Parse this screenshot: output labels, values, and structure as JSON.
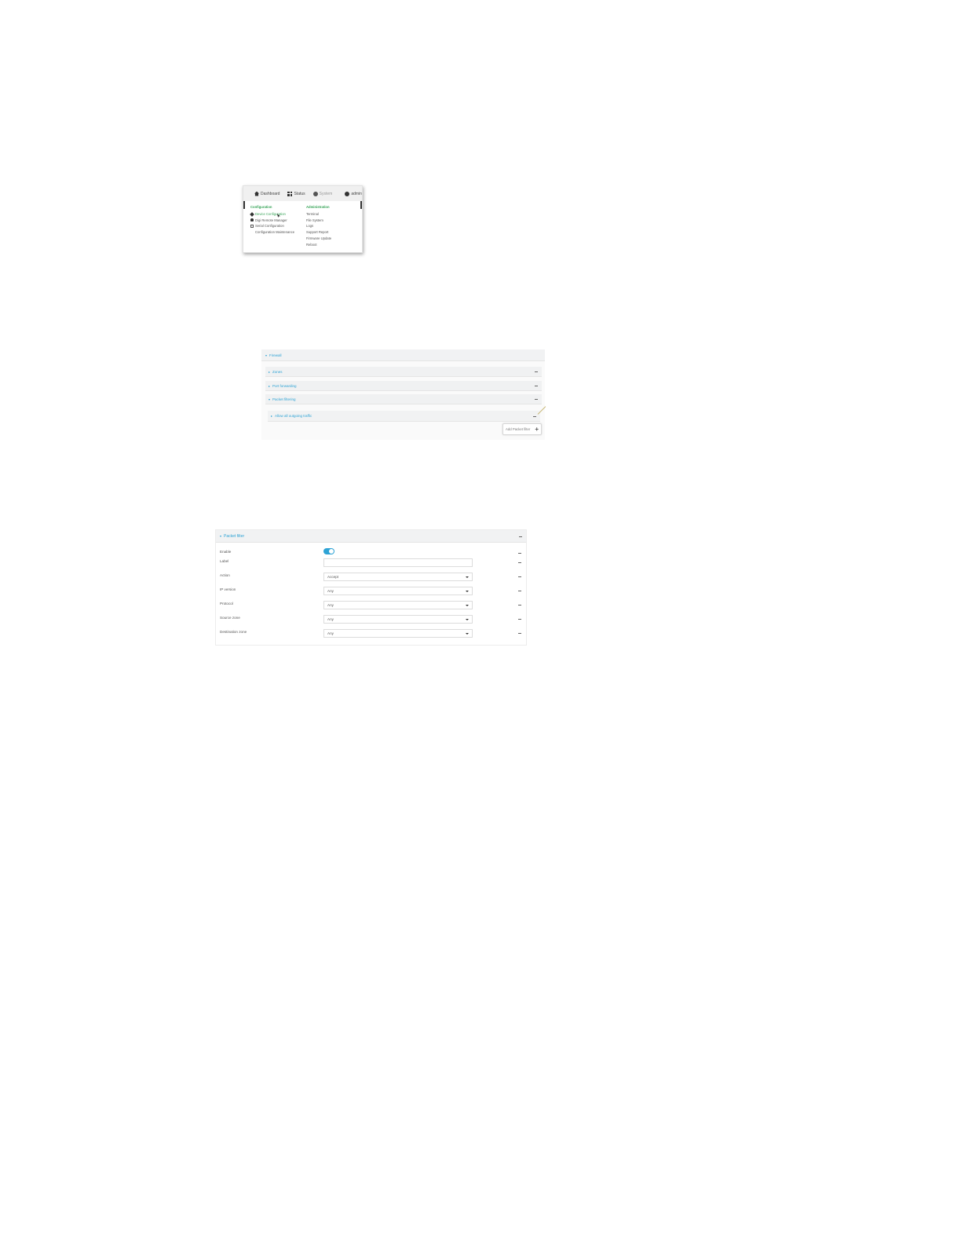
{
  "menu": {
    "nav": {
      "dashboard": "Dashboard",
      "status": "Status",
      "system": "System",
      "admin": "admin"
    },
    "configuration": {
      "heading": "Configuration",
      "items": [
        {
          "label": "Device Configuration",
          "icon": "wrench-icon",
          "active": true
        },
        {
          "label": "Digi Remote Manager",
          "icon": "cloud-icon",
          "active": false
        },
        {
          "label": "Serial Configuration",
          "icon": "serial-icon",
          "active": false
        },
        {
          "label": "Configuration Maintenance",
          "icon": "",
          "active": false
        }
      ]
    },
    "administration": {
      "heading": "Administration",
      "items": [
        "Terminal",
        "File System",
        "Logs",
        "Support Report",
        "Firmware Update",
        "Reboot"
      ]
    }
  },
  "firewall": {
    "title": "Firewall",
    "sections": [
      "Zones",
      "Port forwarding",
      "Packet filtering"
    ],
    "subsection": "Allow all outgoing traffic",
    "add_button": "Add Packet filter"
  },
  "packet_filter": {
    "title": "Packet filter",
    "enable_label": "Enable",
    "enabled": true,
    "label_label": "Label",
    "label_value": "",
    "fields": [
      {
        "label": "Action",
        "value": "Accept"
      },
      {
        "label": "IP version",
        "value": "Any"
      },
      {
        "label": "Protocol",
        "value": "Any"
      },
      {
        "label": "Source zone",
        "value": "Any"
      },
      {
        "label": "Destination zone",
        "value": "Any"
      }
    ]
  },
  "colors": {
    "accent_blue": "#2ea3d5",
    "accent_green": "#3aa55a"
  }
}
